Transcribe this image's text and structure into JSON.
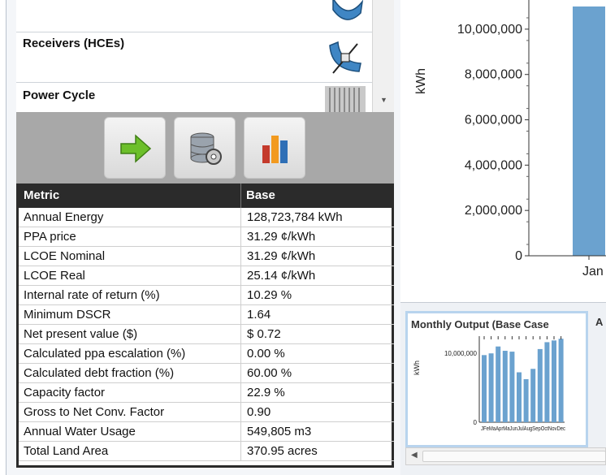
{
  "nav": {
    "items": [
      {
        "label": ""
      },
      {
        "label": "Receivers (HCEs)"
      },
      {
        "label": "Power Cycle"
      }
    ]
  },
  "toolbar": {
    "buttons": [
      {
        "icon": "run-arrow-icon"
      },
      {
        "icon": "database-gear-icon"
      },
      {
        "icon": "bar-chart-icon"
      }
    ]
  },
  "metrics": {
    "header": {
      "metric": "Metric",
      "base": "Base"
    },
    "rows": [
      {
        "metric": "Annual Energy",
        "value": "128,723,784 kWh"
      },
      {
        "metric": "PPA price",
        "value": "31.29 ¢/kWh"
      },
      {
        "metric": "LCOE Nominal",
        "value": "31.29 ¢/kWh"
      },
      {
        "metric": "LCOE Real",
        "value": "25.14 ¢/kWh"
      },
      {
        "metric": "Internal rate of return (%)",
        "value": "10.29 %"
      },
      {
        "metric": "Minimum DSCR",
        "value": "1.64"
      },
      {
        "metric": "Net present value ($)",
        "value": "$ 0.72"
      },
      {
        "metric": "Calculated ppa escalation (%)",
        "value": "0.00 %"
      },
      {
        "metric": "Calculated debt fraction (%)",
        "value": "60.00 %"
      },
      {
        "metric": "Capacity factor",
        "value": "22.9 %"
      },
      {
        "metric": "Gross to Net Conv. Factor",
        "value": "0.90"
      },
      {
        "metric": "Annual Water Usage",
        "value": "549,805 m3"
      },
      {
        "metric": "Total Land Area",
        "value": "370.95 acres"
      }
    ]
  },
  "chart": {
    "ylabel": "kWh",
    "yticks": [
      "10,000,000",
      "8,000,000",
      "6,000,000",
      "4,000,000",
      "2,000,000",
      "0"
    ],
    "xtick": "Jan",
    "bar_color": "#6ba2cf"
  },
  "chart_data": {
    "type": "bar",
    "categories": [
      "Jan"
    ],
    "values": [
      11000000
    ],
    "ylabel": "kWh",
    "ylim": [
      0,
      11000000
    ],
    "yticks": [
      0,
      2000000,
      4000000,
      6000000,
      8000000,
      10000000
    ],
    "grid": false
  },
  "thumbnails": {
    "monthly_title": "Monthly Output (Base Case",
    "second_title": "A",
    "thumb_ylabel": "kWh",
    "thumb_ytick": "10,000,000",
    "thumb_ytick_zero": "0",
    "thumb_xlabels": "JFeMaAprMaJunJulAugSepOctNovDec",
    "monthly_values": [
      0.78,
      0.8,
      0.88,
      0.83,
      0.82,
      0.58,
      0.5,
      0.62,
      0.85,
      0.93,
      0.95,
      0.97
    ]
  }
}
